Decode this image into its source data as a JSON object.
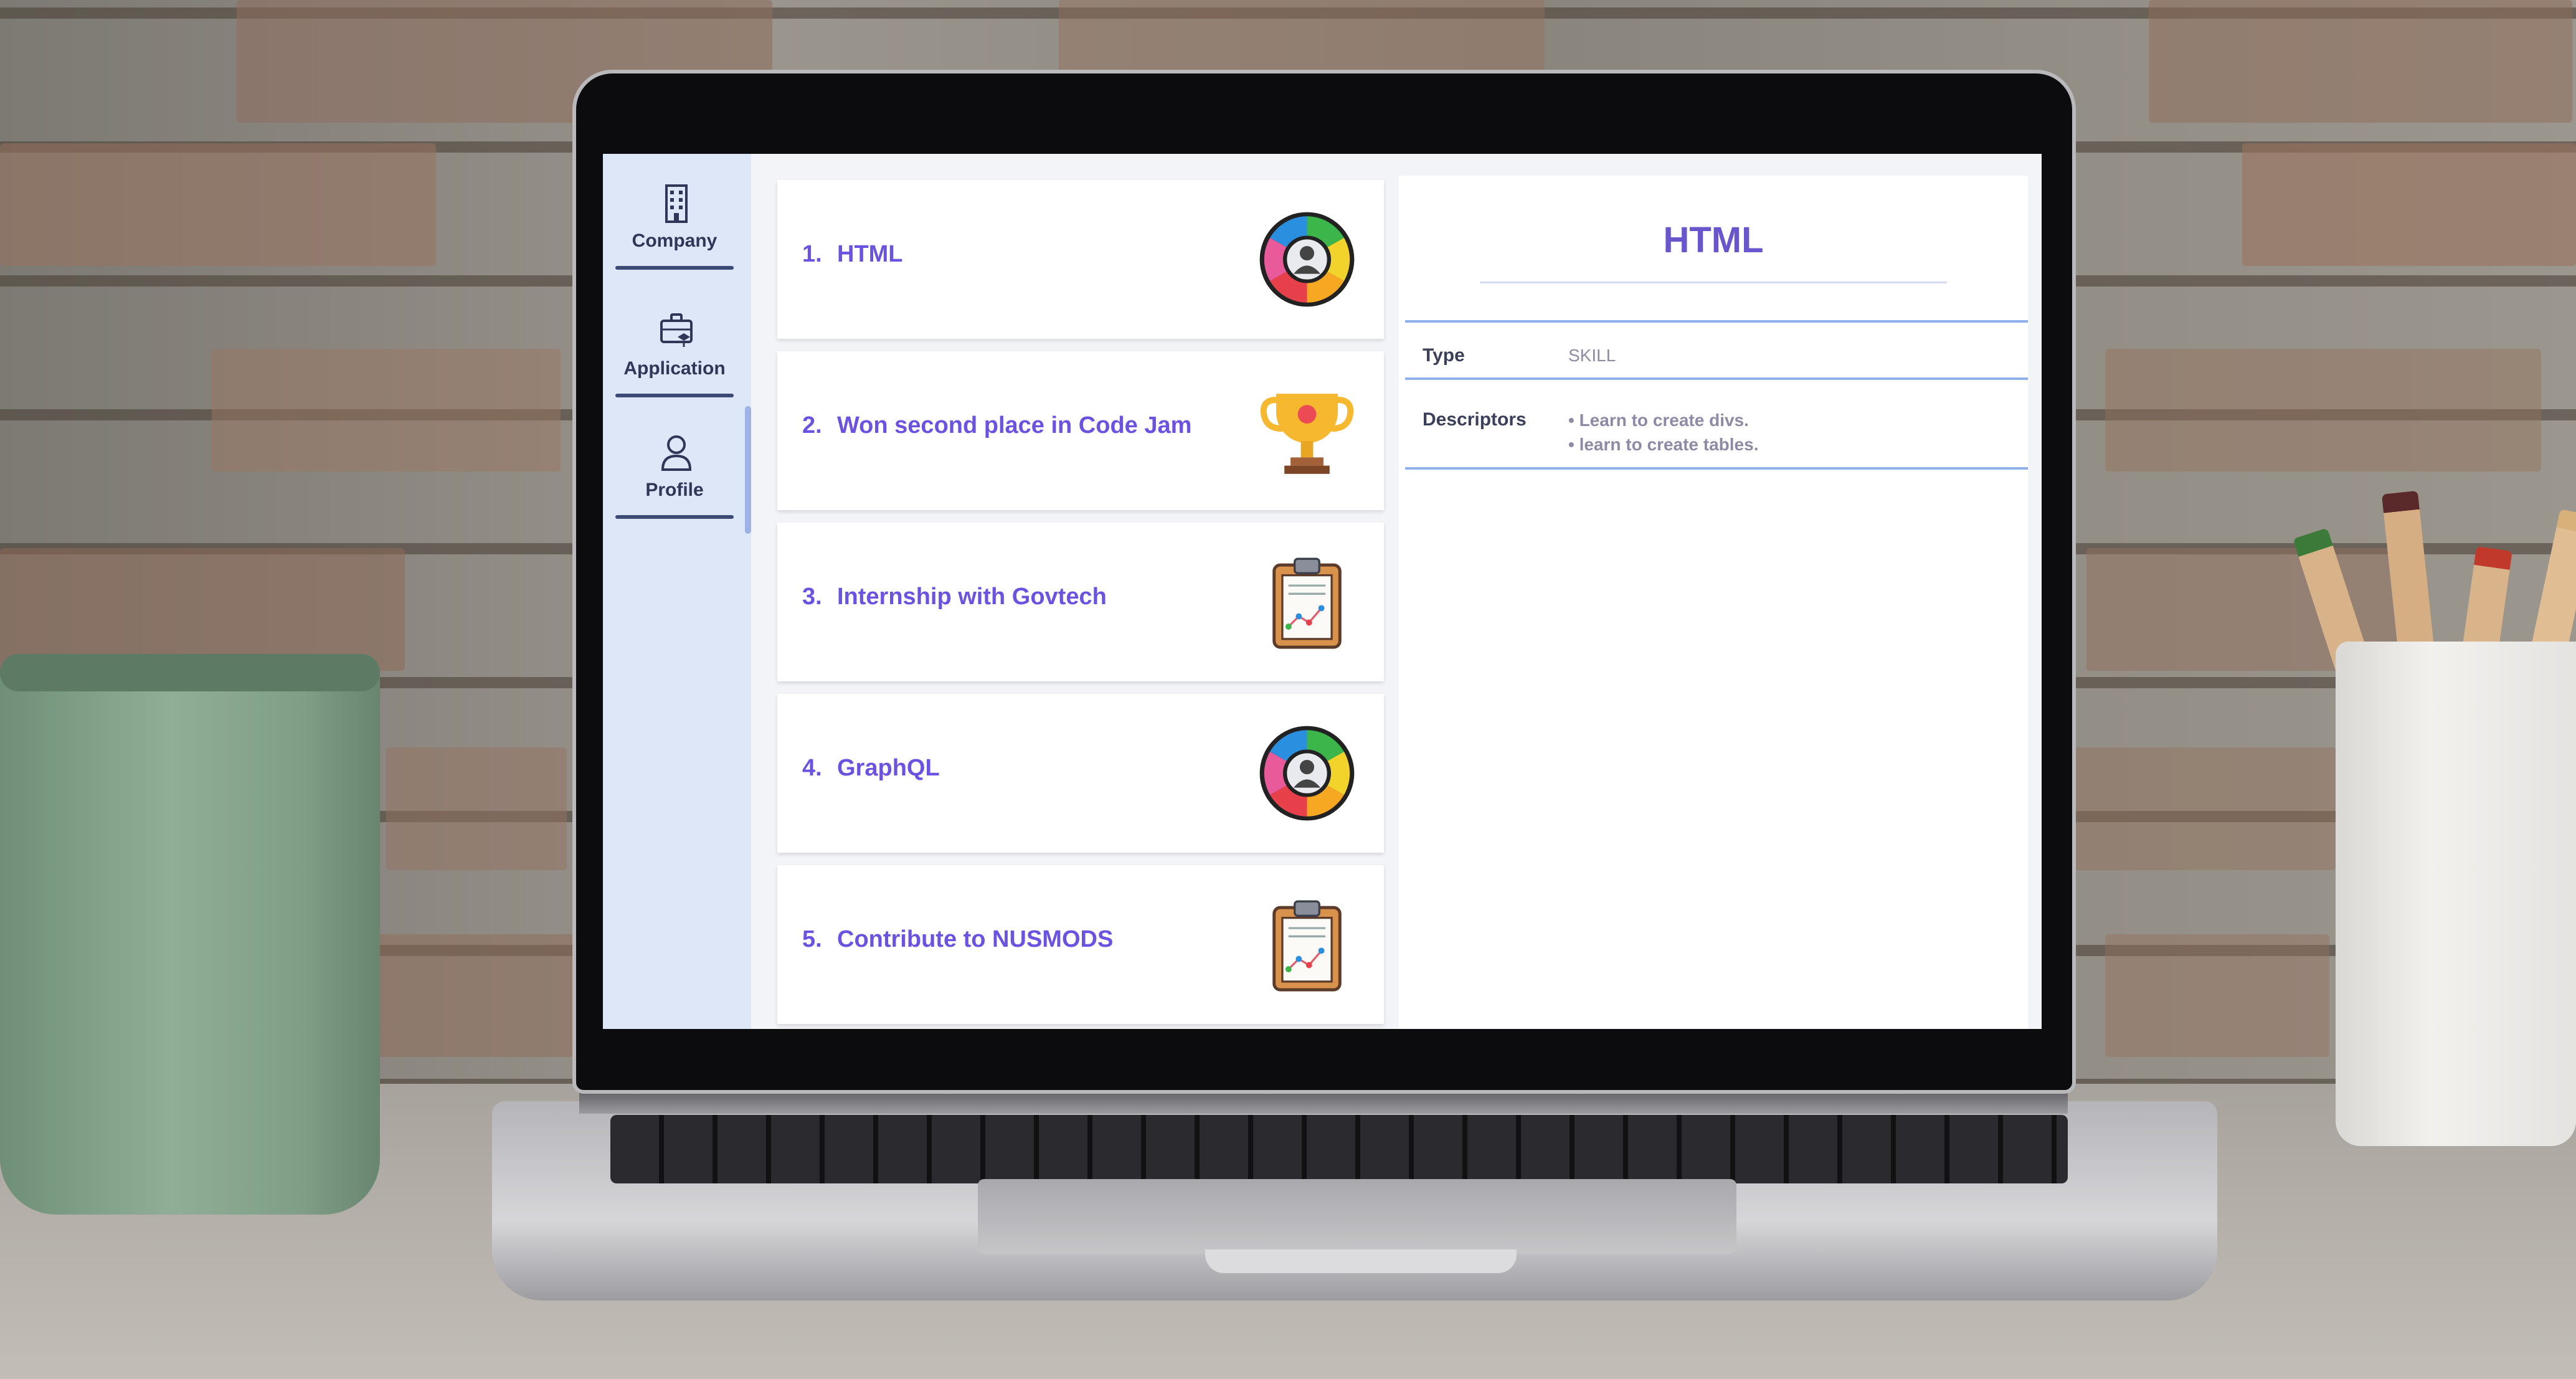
{
  "sidebar": {
    "items": [
      {
        "label": "Company",
        "icon": "building-icon"
      },
      {
        "label": "Application",
        "icon": "briefcase-icon"
      },
      {
        "label": "Profile",
        "icon": "user-icon"
      }
    ]
  },
  "list": {
    "items": [
      {
        "number": "1.",
        "title": "HTML",
        "icon": "skill-wheel-icon"
      },
      {
        "number": "2.",
        "title": "Won second place in Code Jam",
        "icon": "trophy-icon"
      },
      {
        "number": "3.",
        "title": "Internship with Govtech",
        "icon": "clipboard-chart-icon"
      },
      {
        "number": "4.",
        "title": "GraphQL",
        "icon": "skill-wheel-icon"
      },
      {
        "number": "5.",
        "title": "Contribute to NUSMODS",
        "icon": "clipboard-chart-icon"
      }
    ]
  },
  "detail": {
    "title": "HTML",
    "type_label": "Type",
    "type_value": "SKILL",
    "descriptors_label": "Descriptors",
    "descriptors": [
      "• Learn to create divs.",
      "• learn to create tables."
    ]
  },
  "colors": {
    "accent": "#6c52e0",
    "sidebar_bg": "#dde7f8",
    "rule": "#8fb0ea"
  }
}
